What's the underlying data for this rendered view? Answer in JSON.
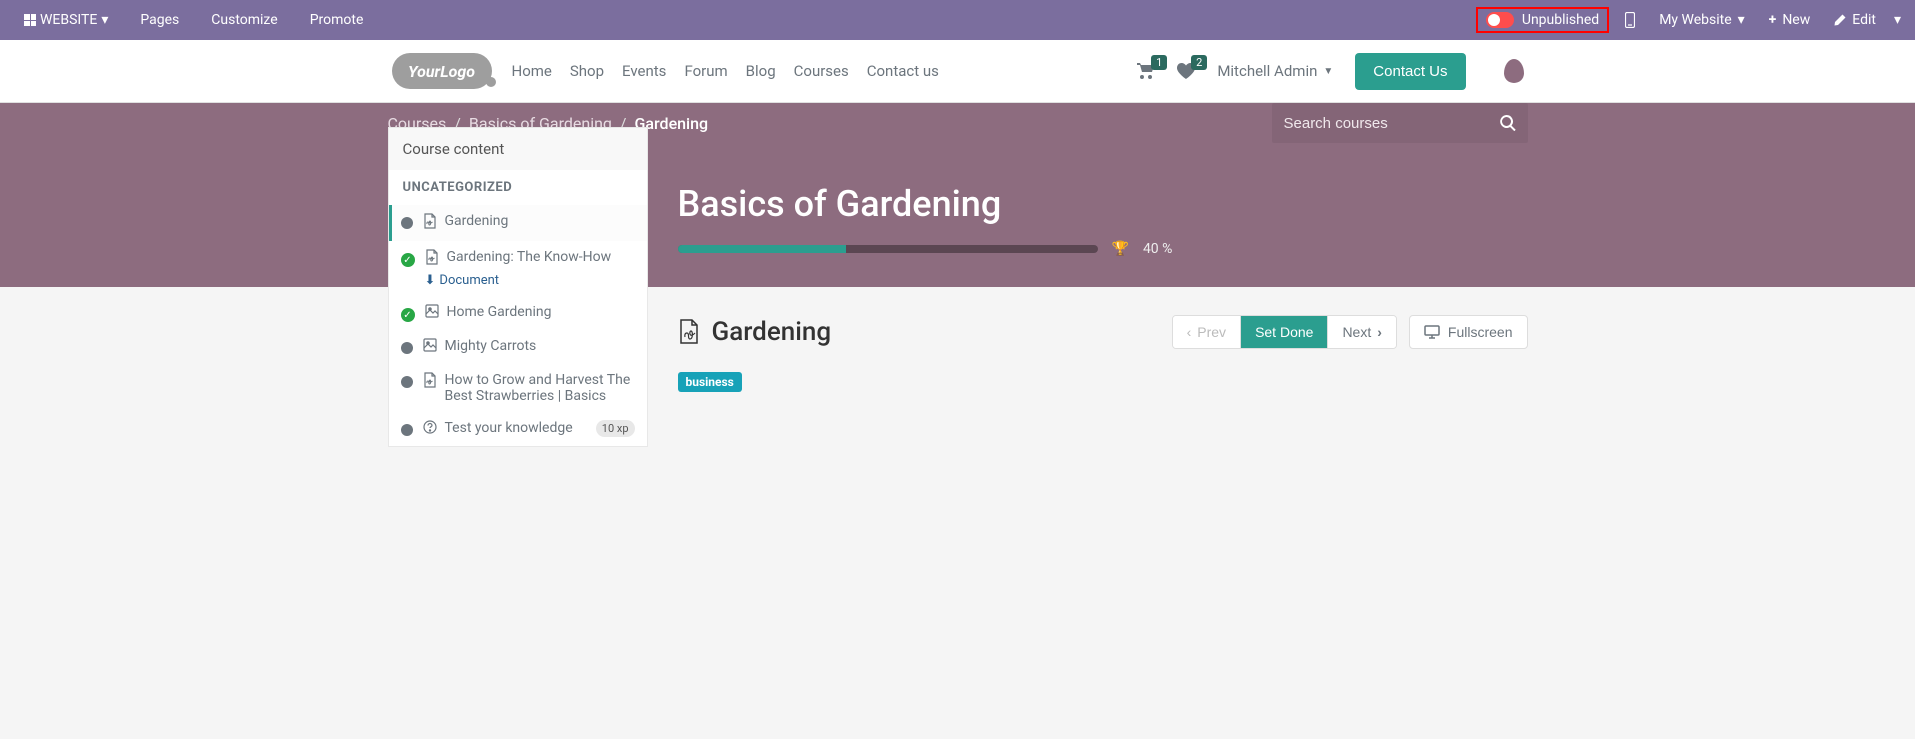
{
  "adminBar": {
    "website": "WEBSITE",
    "pages": "Pages",
    "customize": "Customize",
    "promote": "Promote",
    "published": "Unpublished",
    "myWebsite": "My Website",
    "new": "New",
    "edit": "Edit"
  },
  "nav": {
    "logo": "YourLogo",
    "links": [
      "Home",
      "Shop",
      "Events",
      "Forum",
      "Blog",
      "Courses",
      "Contact us"
    ],
    "cartCount": "1",
    "wishCount": "2",
    "user": "Mitchell Admin",
    "contact": "Contact Us"
  },
  "breadcrumb": {
    "items": [
      "Courses",
      "Basics of Gardening"
    ],
    "current": "Gardening"
  },
  "search": {
    "placeholder": "Search courses"
  },
  "hero": {
    "title": "Basics of Gardening",
    "progress": "40 %"
  },
  "sidebar": {
    "header": "Course content",
    "category": "UNCATEGORIZED",
    "items": [
      {
        "title": "Gardening",
        "icon": "pdf",
        "status": "dot",
        "active": true
      },
      {
        "title": "Gardening: The Know-How",
        "icon": "pdf",
        "status": "check",
        "doc": "Document"
      },
      {
        "title": "Home Gardening",
        "icon": "image",
        "status": "check"
      },
      {
        "title": "Mighty Carrots",
        "icon": "image",
        "status": "dot"
      },
      {
        "title": "How to Grow and Harvest The Best Strawberries | Basics",
        "icon": "pdf",
        "status": "dot"
      },
      {
        "title": "Test your knowledge",
        "icon": "question",
        "status": "dot",
        "xp": "10 xp"
      }
    ]
  },
  "content": {
    "title": "Gardening",
    "prev": "Prev",
    "setDone": "Set Done",
    "next": "Next",
    "fullscreen": "Fullscreen",
    "tag": "business"
  }
}
